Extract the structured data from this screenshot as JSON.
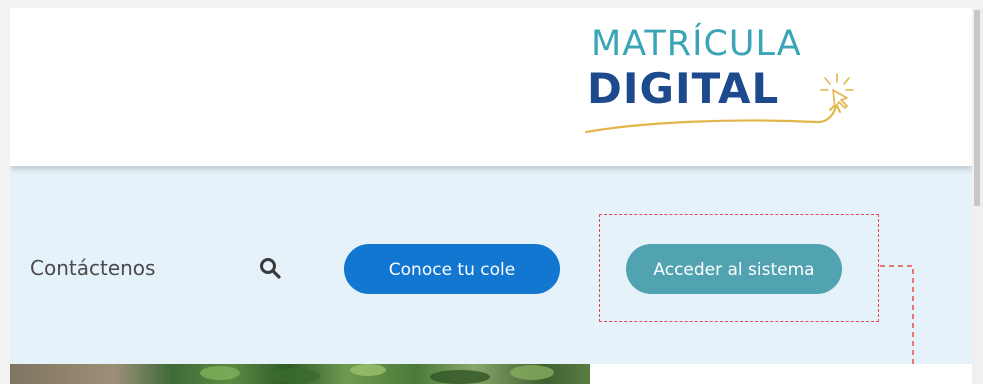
{
  "logo": {
    "line1": "MATRÍCULA",
    "line2": "DIGITAL"
  },
  "nav": {
    "contact_label": "Contáctenos",
    "search_icon": "search-icon",
    "cole_button_label": "Conoce tu cole",
    "acceder_button_label": "Acceder al sistema"
  },
  "colors": {
    "logo_teal": "#3aa6b5",
    "logo_navy": "#1c4a8c",
    "logo_swoosh": "#e3b64c",
    "nav_background": "#e6f2f9",
    "primary_button": "#1177d1",
    "secondary_button": "#52a3b1",
    "highlight_annotation": "#e84a4a"
  }
}
